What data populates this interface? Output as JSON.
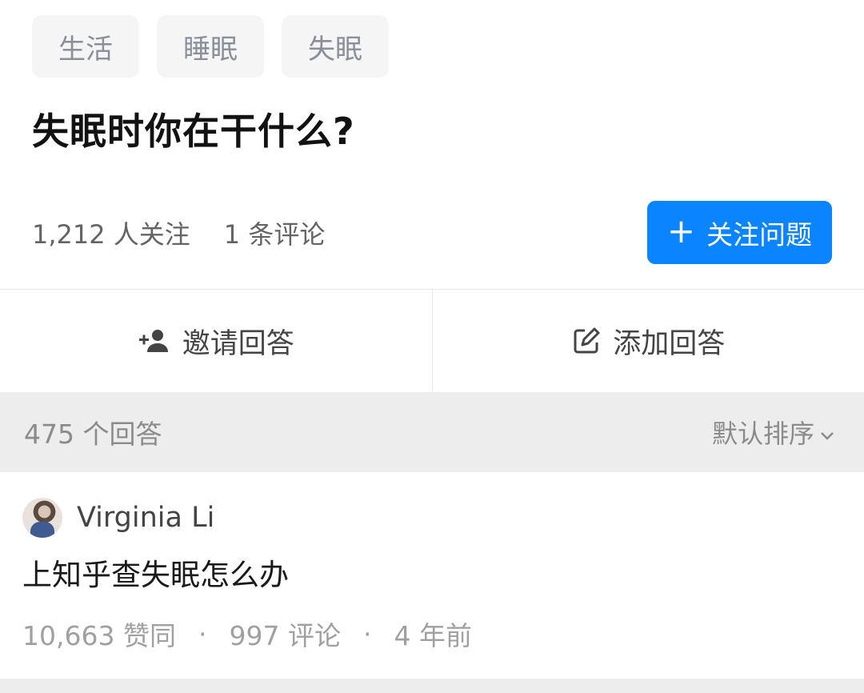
{
  "topics": [
    "生活",
    "睡眠",
    "失眠"
  ],
  "question": {
    "title": "失眠时你在干什么?",
    "followers": "1,212 人关注",
    "comments": "1 条评论",
    "follow_button": "关注问题",
    "follow_icon": "plus-icon"
  },
  "actions": {
    "invite_label": "邀请回答",
    "invite_icon": "invite-person-icon",
    "add_label": "添加回答",
    "add_icon": "edit-icon"
  },
  "answers_header": {
    "count": "475 个回答",
    "sort_label": "默认排序",
    "sort_icon": "chevron-down-icon"
  },
  "answer": {
    "author": "Virginia Li",
    "excerpt": "上知乎查失眠怎么办",
    "likes": "10,663 赞同",
    "comments": "997 评论",
    "time": "4 年前"
  },
  "colors": {
    "accent": "#0b84ff",
    "tag_bg": "#f5f5f6",
    "section_bg": "#ededee"
  }
}
